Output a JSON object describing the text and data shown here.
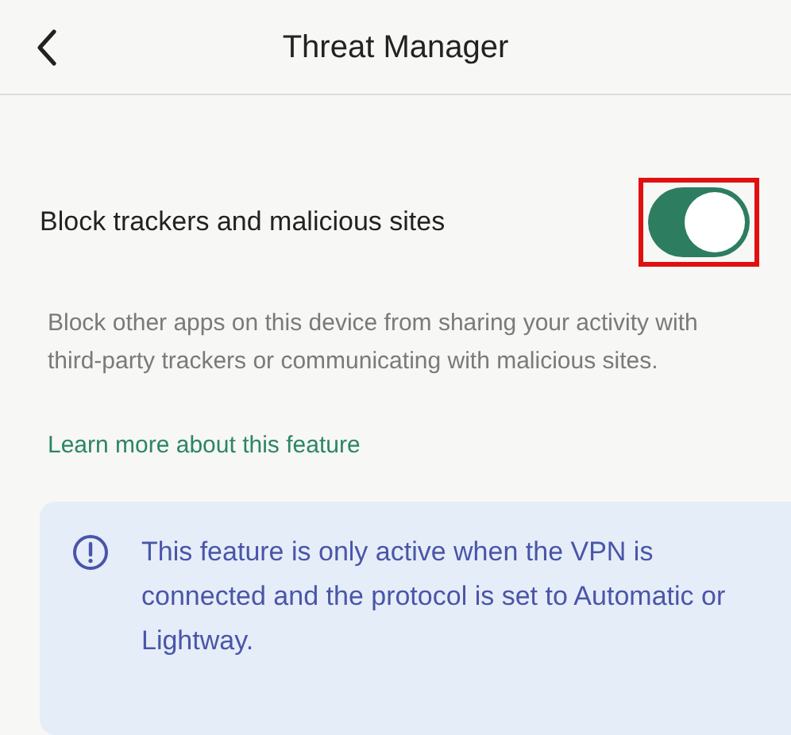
{
  "header": {
    "title": "Threat Manager"
  },
  "setting": {
    "label": "Block trackers and malicious sites",
    "on": true,
    "highlighted": true
  },
  "description": "Block other apps on this device from sharing your activity with third-party trackers or communicating with malicious sites.",
  "link": "Learn more about this feature",
  "notice": "This feature is only active when the VPN is connected and the protocol is set to Automatic or Lightway."
}
